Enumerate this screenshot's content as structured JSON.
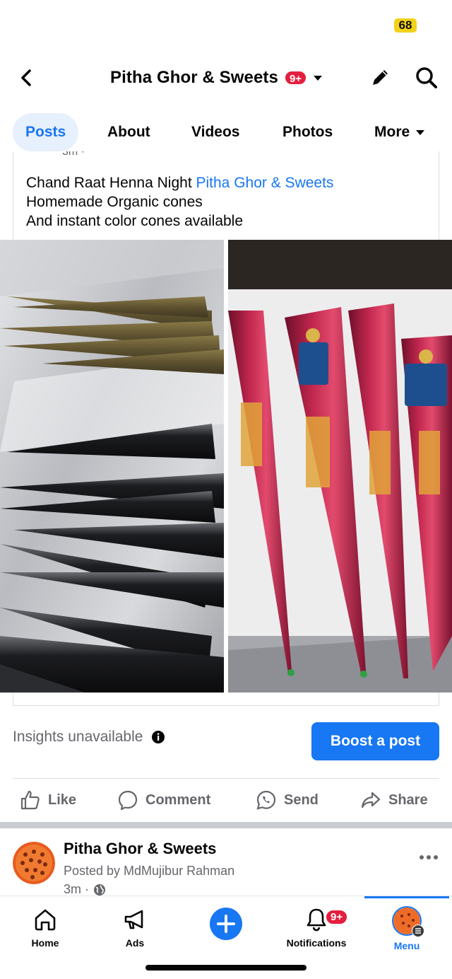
{
  "status_bar": {
    "battery": "68"
  },
  "header": {
    "title": "Pitha Ghor & Sweets",
    "badge": "9+"
  },
  "tabs": [
    {
      "label": "Posts",
      "active": true
    },
    {
      "label": "About"
    },
    {
      "label": "Videos"
    },
    {
      "label": "Photos"
    },
    {
      "label": "More"
    }
  ],
  "post": {
    "meta_cut": "3m ·",
    "line1_text": "Chand Raat Henna Night ",
    "line1_link": "Pitha Ghor & Sweets",
    "line2": "Homemade Organic cones",
    "line3": "And instant color cones available"
  },
  "insights": {
    "label": "Insights unavailable",
    "boost": "Boost a post"
  },
  "actions": {
    "like": "Like",
    "comment": "Comment",
    "send": "Send",
    "share": "Share"
  },
  "next_post": {
    "title": "Pitha Ghor & Sweets",
    "posted_by": "Posted by MdMujibur Rahman",
    "time": "3m ·"
  },
  "bottom_nav": {
    "home": "Home",
    "ads": "Ads",
    "notifications": "Notifications",
    "notif_badge": "9+",
    "menu": "Menu"
  },
  "colors": {
    "accent": "#1877f2",
    "badge": "#e41e3f",
    "battery": "#f4d21b"
  }
}
